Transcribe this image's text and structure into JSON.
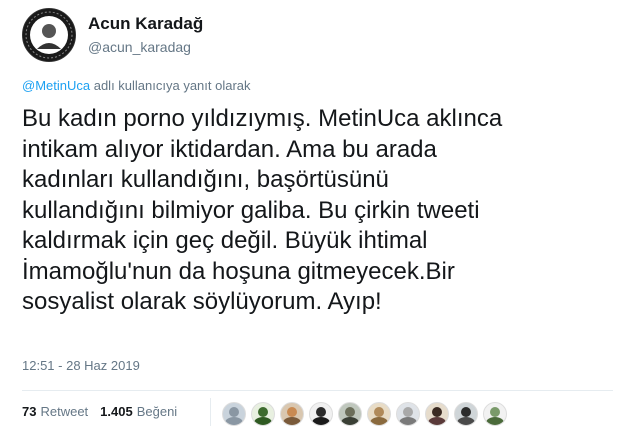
{
  "author": {
    "display_name": "Acun Karadağ",
    "handle": "@acun_karadag",
    "avatar_icon": "profile-photo-circular-badge"
  },
  "reply": {
    "mention": "@MetinUca",
    "suffix": " adlı kullanıcıya yanıt olarak"
  },
  "tweet": {
    "text": "Bu kadın porno yıldızıymış. MetinUca aklınca\nintikam alıyor iktidardan. Ama bu arada\nkadınları kullandığını, başörtüsünü\nkullandığını bilmiyor galiba. Bu çirkin tweeti\nkaldırmak için geç değil. Büyük ihtimal\nİmamoğlu'nun da hoşuna gitmeyecek.Bir\nsosyalist olarak söylüyorum. Ayıp!",
    "timestamp": "12:51 - 28 Haz 2019"
  },
  "stats": {
    "retweets_count": "73",
    "retweets_label": "Retweet",
    "likes_count": "1.405",
    "likes_label": "Beğeni"
  },
  "likers": [
    {
      "name": "liker-avatar-1",
      "bg": "#c9d3dc",
      "face": "#8a97a3",
      "body": "#8a97a3"
    },
    {
      "name": "liker-avatar-2",
      "bg": "#e8f0e0",
      "face": "#3d6b2e",
      "body": "#2f5a22"
    },
    {
      "name": "liker-avatar-3",
      "bg": "#d9c7b0",
      "face": "#c98a52",
      "body": "#7a5a3a"
    },
    {
      "name": "liker-avatar-4",
      "bg": "#f0f0f0",
      "face": "#2a2a2a",
      "body": "#1a1a1a"
    },
    {
      "name": "liker-avatar-5",
      "bg": "#bfc7bd",
      "face": "#6b6e5a",
      "body": "#3a3f35"
    },
    {
      "name": "liker-avatar-6",
      "bg": "#e8dcc6",
      "face": "#b08a5a",
      "body": "#8a6a3e"
    },
    {
      "name": "liker-avatar-7",
      "bg": "#dfe3e8",
      "face": "#a9a9a9",
      "body": "#7a7a7a"
    },
    {
      "name": "liker-avatar-8",
      "bg": "#e6dccc",
      "face": "#3a2a22",
      "body": "#5a3a3a"
    },
    {
      "name": "liker-avatar-9",
      "bg": "#cfd5d8",
      "face": "#2c2c2c",
      "body": "#4a4a4a"
    },
    {
      "name": "liker-avatar-10",
      "bg": "#f2f2f2",
      "face": "#7a9a6a",
      "body": "#4a6a3a"
    }
  ],
  "colors": {
    "link": "#1da1f2",
    "text": "#14171a",
    "secondary": "#657786"
  }
}
